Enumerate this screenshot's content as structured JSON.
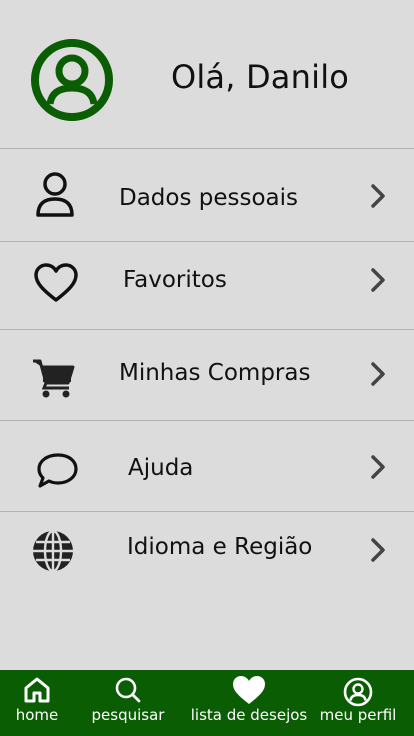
{
  "header": {
    "greeting": "Olá, Danilo",
    "avatar_icon": "user-circle-icon",
    "avatar_color": "#0b5d04"
  },
  "menu": {
    "items": [
      {
        "label": "Dados pessoais",
        "icon": "person-icon"
      },
      {
        "label": "Favoritos",
        "icon": "heart-icon"
      },
      {
        "label": "Minhas Compras",
        "icon": "cart-icon"
      },
      {
        "label": "Ajuda",
        "icon": "chat-bubble-icon"
      },
      {
        "label": "Idioma e Região",
        "icon": "globe-icon"
      }
    ],
    "chevron_icon": "chevron-right-icon"
  },
  "bottom_nav": {
    "background": "#0b5d04",
    "items": [
      {
        "label": "home",
        "icon": "home-icon"
      },
      {
        "label": "pesquisar",
        "icon": "search-icon"
      },
      {
        "label": "lista de desejos",
        "icon": "heart-filled-icon"
      },
      {
        "label": "meu perfil",
        "icon": "user-circle-icon"
      }
    ]
  }
}
